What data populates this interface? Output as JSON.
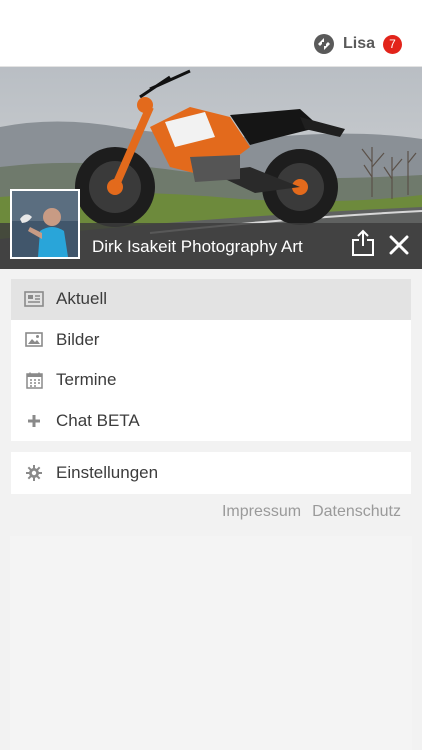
{
  "header": {
    "user_name": "Lisa",
    "notification_count": "7",
    "logo_icon": "user-logo-icon"
  },
  "hero": {
    "title": "Dirk Isakeit Photography Art",
    "share_icon": "share-icon",
    "close_icon": "close-icon"
  },
  "menu": {
    "items": [
      {
        "label": "Aktuell",
        "icon": "newspaper-icon",
        "active": true
      },
      {
        "label": "Bilder",
        "icon": "image-icon",
        "active": false
      },
      {
        "label": "Termine",
        "icon": "calendar-icon",
        "active": false
      },
      {
        "label": "Chat BETA",
        "icon": "plus-icon",
        "active": false
      }
    ],
    "settings": {
      "label": "Einstellungen",
      "icon": "gear-icon"
    }
  },
  "footer": {
    "impressum": "Impressum",
    "datenschutz": "Datenschutz"
  },
  "colors": {
    "badge": "#e2231a",
    "active_item": "#e3e3e3",
    "background": "#f2f2f2"
  }
}
